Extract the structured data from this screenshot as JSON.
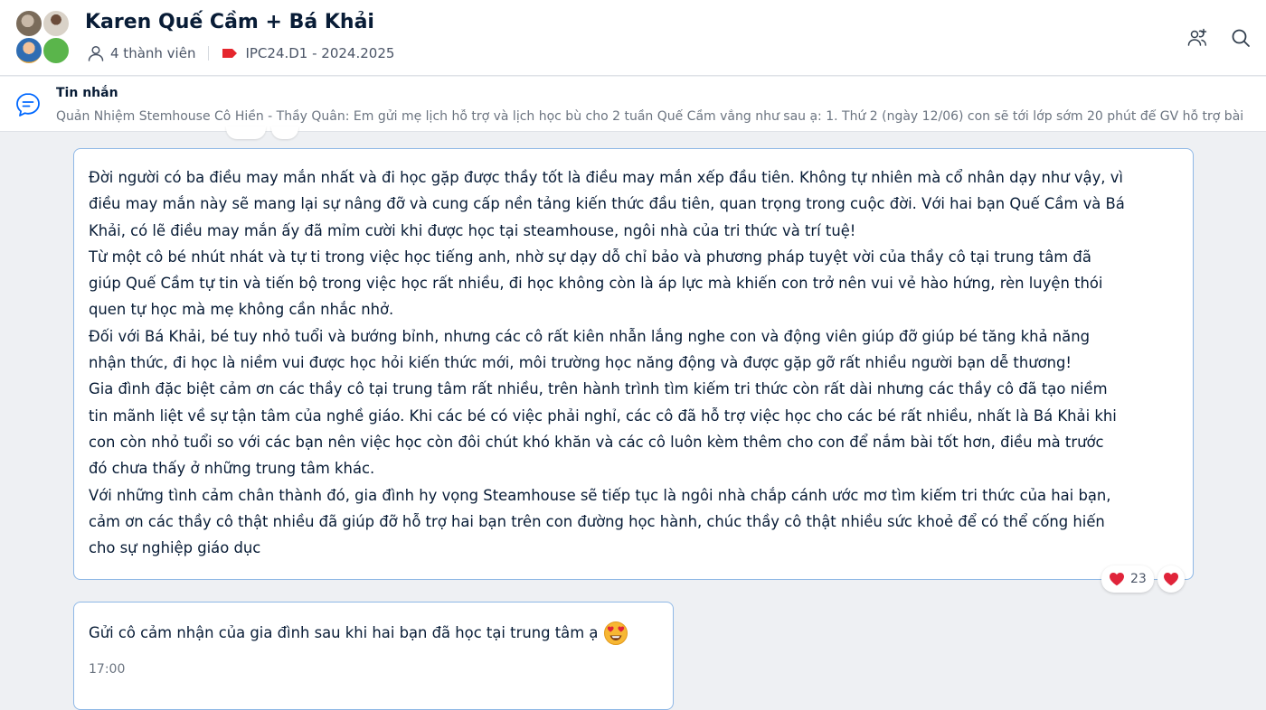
{
  "header": {
    "title": "Karen Quế Cầm + Bá Khải",
    "member_count": "4 thành viên",
    "label": "IPC24.D1 - 2024.2025",
    "label_color": "#e5262d",
    "icons": [
      "add-member-icon",
      "search-icon"
    ]
  },
  "pinned": {
    "title": "Tin nhắn",
    "text": "Quản Nhiệm Stemhouse Cô Hiền - Thầy Quân: Em gửi mẹ lịch hỗ trợ và lịch học bù cho 2 tuần Quế Cầm vắng như sau ạ: 1. Thứ 2 (ngày 12/06) con sẽ tới lớp sớm 20 phút để GV hỗ trợ bài"
  },
  "messages": [
    {
      "lines": [
        "Đời người có ba điều may mắn nhất và đi học gặp được thầy tốt là điều may mắn xếp đầu tiên. Không tự nhiên mà cổ nhân dạy như vậy, vì",
        "điều may mắn này sẽ mang lại sự nâng đỡ và cung cấp nền tảng kiến thức đầu tiên, quan trọng trong cuộc đời. Với hai bạn Quế Cầm và Bá",
        "Khải, có lẽ điều may mắn ấy đã mỉm cười  khi được học tại steamhouse, ngôi nhà của tri thức và trí tuệ!",
        "Từ một cô bé nhút nhát và tự ti trong việc học tiếng anh, nhờ sự dạy dỗ chỉ bảo và phương pháp tuyệt vời của thầy cô tại trung tâm đã",
        "giúp Quế Cầm tự tin và tiến bộ trong việc học rất nhiều, đi học không còn là áp lực mà khiến con trở nên vui vẻ hào hứng, rèn luyện thói",
        "quen tự học mà mẹ không cần nhắc nhở.",
        "Đối với Bá Khải, bé tuy nhỏ tuổi và bướng bỉnh, nhưng các cô rất kiên nhẫn lắng nghe con và động viên giúp đỡ giúp bé tăng khả năng",
        "nhận thức, đi học là niềm vui được học hỏi kiến thức mới, môi trường học năng động và được gặp gỡ rất nhiều người bạn dễ thương!",
        "Gia đình đặc biệt cảm ơn các thầy cô tại trung tâm rất nhiều, trên hành trình tìm kiếm tri thức còn rất dài nhưng các thầy cô đã tạo niềm",
        "tin mãnh liệt về sự tận tâm của nghề giáo. Khi các bé có việc phải nghỉ, các cô đã hỗ trợ việc học cho các bé rất nhiều, nhất là Bá Khải khi",
        "con còn nhỏ tuổi so với các bạn nên việc học còn đôi chút khó khăn và các cô luôn kèm thêm cho con để nắm bài tốt hơn, điều mà trước",
        "đó chưa thấy ở những trung tâm khác.",
        "Với những tình cảm chân thành đó, gia đình hy vọng Steamhouse sẽ tiếp tục là ngôi nhà chắp cánh ước mơ tìm kiếm tri thức của hai bạn,",
        "cảm ơn các thầy cô thật nhiều đã giúp đỡ hỗ trợ hai bạn trên con đường học hành, chúc thầy cô thật nhiều sức khoẻ để có thể cống hiến",
        "cho sự nghiệp giáo dục"
      ],
      "reaction_count": "23"
    },
    {
      "text": "Gửi cô cảm nhận của gia đình sau khi hai bạn đã học tại trung tâm ạ",
      "emoji": "heart-eyes-emoji",
      "time": "17:00"
    }
  ],
  "colors": {
    "bubble_border": "#8fb8e6",
    "heart": "#e0243a",
    "background": "#eef0f3"
  }
}
